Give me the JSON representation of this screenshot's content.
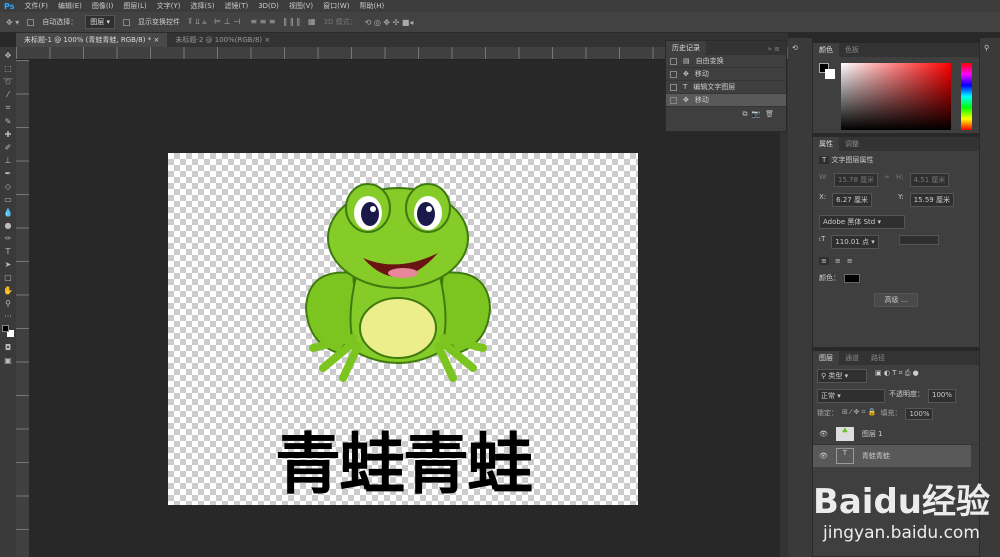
{
  "menu": {
    "logo": "Ps",
    "items": [
      "文件(F)",
      "编辑(E)",
      "图像(I)",
      "图层(L)",
      "文字(Y)",
      "选择(S)",
      "滤镜(T)",
      "3D(D)",
      "视图(V)",
      "窗口(W)",
      "帮助(H)"
    ]
  },
  "options": {
    "auto_select": "自动选择：",
    "layer_select": "图层",
    "show_transform": "显示变换控件",
    "mode_3d": "3D 模式："
  },
  "tabs": [
    {
      "label": "未标题-1 @ 100% (青蛙青蛙, RGB/8) *",
      "close": "×"
    },
    {
      "label": "未标题-2 @ 100%(RGB/8)",
      "close": "×"
    }
  ],
  "history": {
    "title": "历史记录",
    "items": [
      "自由变换",
      "移动",
      "编辑文字图层",
      "移动"
    ]
  },
  "color": {
    "tabs": [
      "颜色",
      "色板"
    ]
  },
  "properties": {
    "tabs": [
      "属性",
      "调整"
    ],
    "title": "文字图层属性",
    "w": "15.78 厘米",
    "h": "4.51 厘米",
    "x": "6.27 厘米",
    "y": "15.59 厘米",
    "w_label": "W:",
    "h_label": "H:",
    "x_label": "X:",
    "y_label": "Y:",
    "font": "Adobe 黑体 Std",
    "size": "110.01 点",
    "color_label": "颜色：",
    "advanced": "高级 ..."
  },
  "layers": {
    "tabs": [
      "图层",
      "通道",
      "路径"
    ],
    "filter": "类型",
    "blend": "正常",
    "opacity_label": "不透明度：",
    "opacity": "100%",
    "lock_label": "锁定：",
    "fill_label": "填充：",
    "fill": "100%",
    "items": [
      "图层 1",
      "青蛙青蛙"
    ]
  },
  "canvas": {
    "text": "青蛙青蛙"
  },
  "watermark": {
    "brand": "Baidu经验",
    "url": "jingyan.baidu.com"
  }
}
